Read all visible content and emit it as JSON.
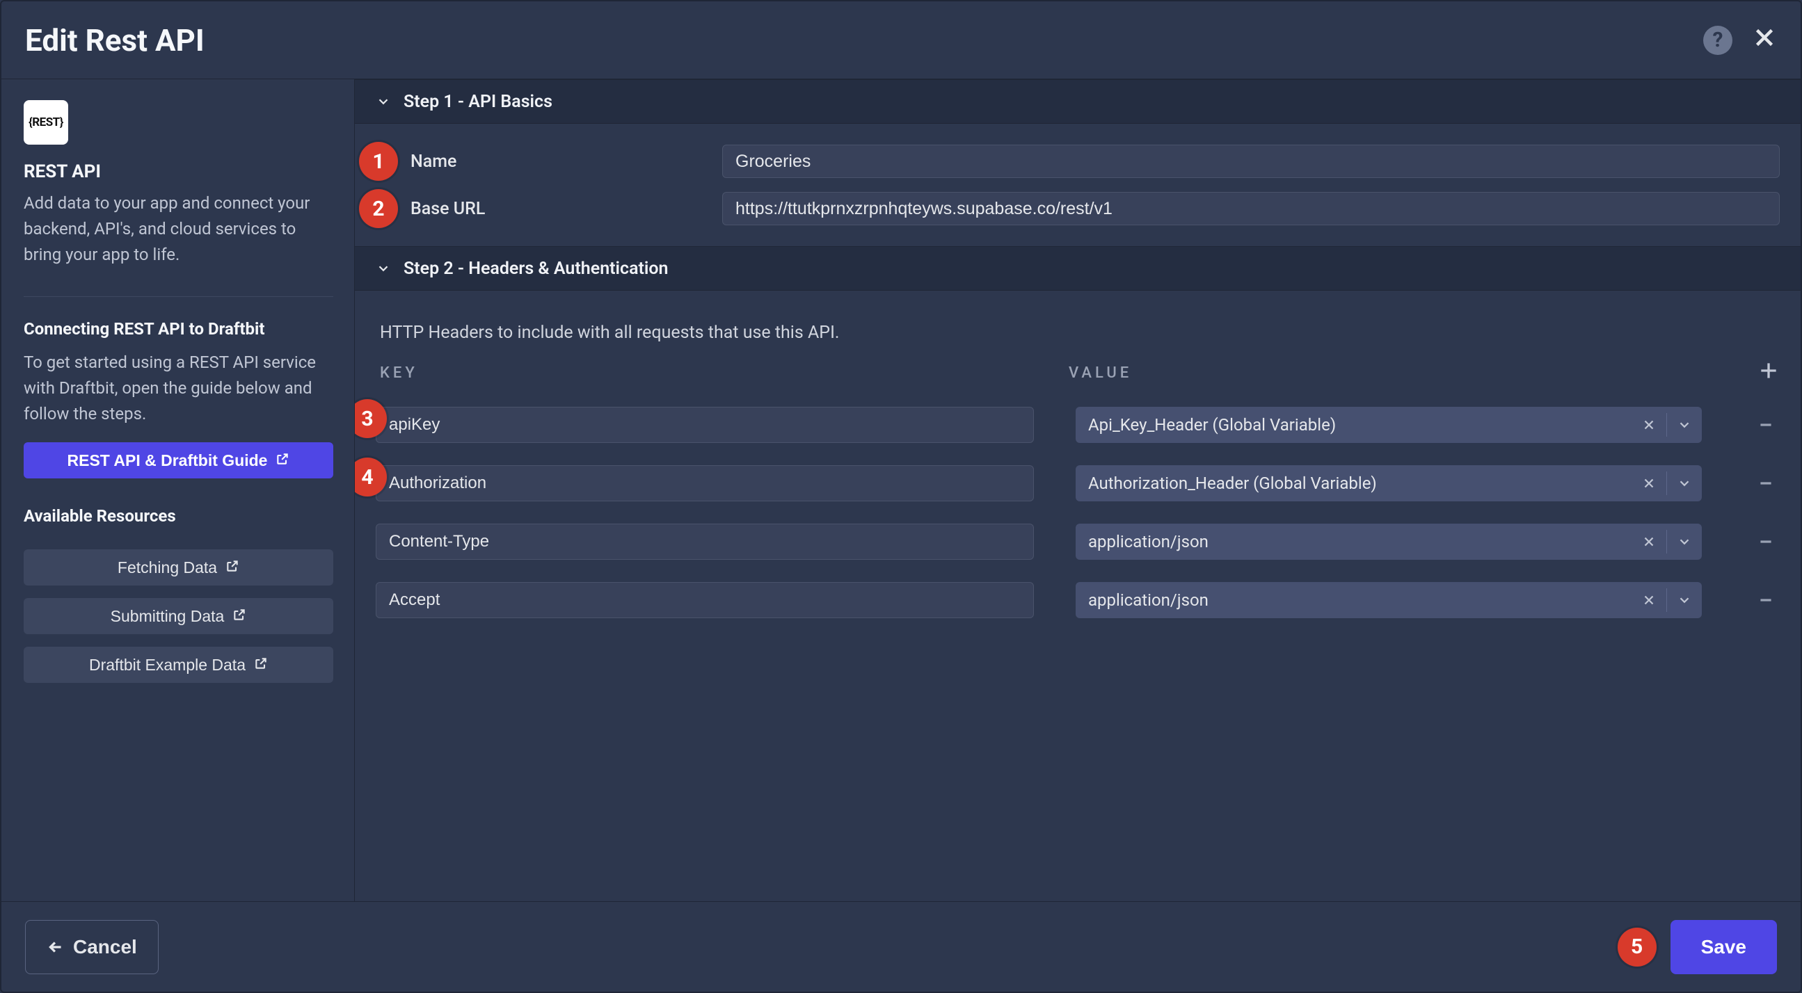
{
  "header": {
    "title": "Edit Rest API"
  },
  "sidebar": {
    "iconText": "{REST}",
    "title": "REST API",
    "desc": "Add data to your app and connect your backend, API's, and cloud services to bring your app to life.",
    "connect": {
      "heading": "Connecting REST API to Draftbit",
      "desc": "To get started using a REST API service with Draftbit, open the guide below and follow the steps.",
      "button": "REST API & Draftbit Guide"
    },
    "res": {
      "heading": "Available Resources",
      "items": [
        "Fetching Data",
        "Submitting Data",
        "Draftbit Example Data"
      ]
    }
  },
  "step1": {
    "title": "Step 1 - API Basics",
    "nameLabel": "Name",
    "nameValue": "Groceries",
    "baseLabel": "Base URL",
    "baseValue": "https://ttutkprnxzrpnhqteyws.supabase.co/rest/v1"
  },
  "step2": {
    "title": "Step 2 - Headers & Authentication",
    "note": "HTTP Headers to include with all requests that use this API.",
    "keyHeader": "KEY",
    "valHeader": "VALUE",
    "rows": [
      {
        "key": "apiKey",
        "val": "Api_Key_Header (Global Variable)"
      },
      {
        "key": "Authorization",
        "val": "Authorization_Header (Global Variable)"
      },
      {
        "key": "Content-Type",
        "val": "application/json"
      },
      {
        "key": "Accept",
        "val": "application/json"
      }
    ]
  },
  "footer": {
    "cancel": "Cancel",
    "save": "Save"
  },
  "callouts": {
    "c1": "1",
    "c2": "2",
    "c3": "3",
    "c4": "4",
    "c5": "5"
  }
}
